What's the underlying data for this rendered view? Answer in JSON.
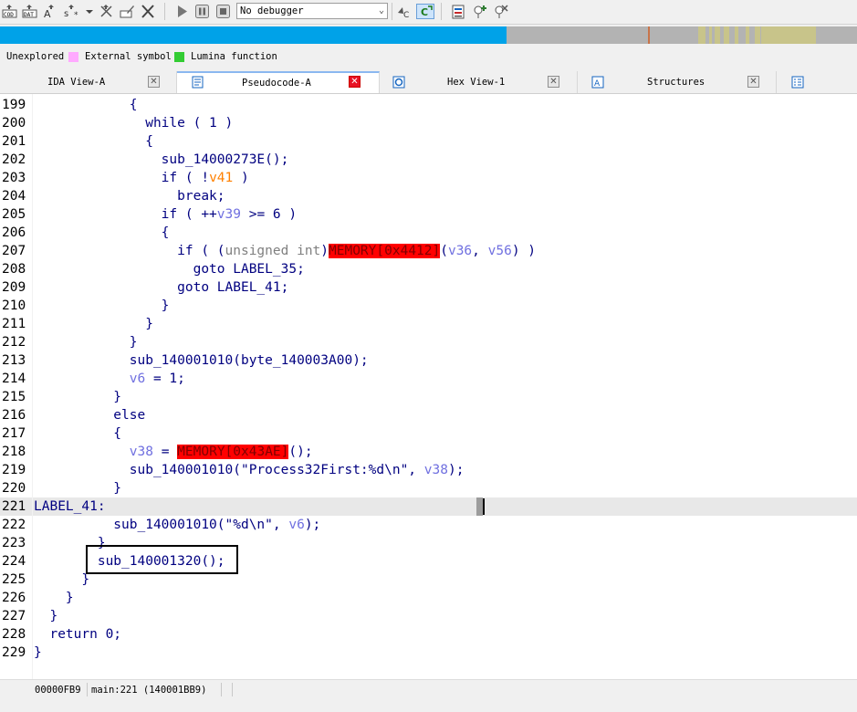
{
  "toolbar": {
    "debugger_value": "No debugger"
  },
  "legend": {
    "unexplored": "Unexplored",
    "external": "External symbol",
    "lumina": "Lumina function",
    "colors": {
      "external": "#ffaaff",
      "lumina": "#33cc33"
    }
  },
  "tabs": [
    {
      "label": "IDA View-A",
      "active": false
    },
    {
      "label": "Pseudocode-A",
      "active": true
    },
    {
      "label": "Hex View-1",
      "active": false
    },
    {
      "label": "Structures",
      "active": false
    }
  ],
  "code": {
    "lines": [
      {
        "num": "199",
        "parts": [
          {
            "t": "            {",
            "c": "code"
          }
        ]
      },
      {
        "num": "200",
        "parts": [
          {
            "t": "              while ( 1 )",
            "c": "code"
          }
        ]
      },
      {
        "num": "201",
        "parts": [
          {
            "t": "              {",
            "c": "code"
          }
        ]
      },
      {
        "num": "202",
        "parts": [
          {
            "t": "                sub_14000273E();",
            "c": "code"
          }
        ]
      },
      {
        "num": "203",
        "parts": [
          {
            "t": "                if ( !",
            "c": "code"
          },
          {
            "t": "v41",
            "c": "orange"
          },
          {
            "t": " )",
            "c": "code"
          }
        ]
      },
      {
        "num": "204",
        "parts": [
          {
            "t": "                  break;",
            "c": "code"
          }
        ]
      },
      {
        "num": "205",
        "parts": [
          {
            "t": "                if ( ++",
            "c": "code"
          },
          {
            "t": "v39",
            "c": "var"
          },
          {
            "t": " >= 6 )",
            "c": "code"
          }
        ]
      },
      {
        "num": "206",
        "parts": [
          {
            "t": "                {",
            "c": "code"
          }
        ]
      },
      {
        "num": "207",
        "parts": [
          {
            "t": "                  if ( (",
            "c": "code"
          },
          {
            "t": "unsigned int",
            "c": "gray"
          },
          {
            "t": ")",
            "c": "code"
          },
          {
            "t": "MEMORY[0x4412]",
            "c": "red"
          },
          {
            "t": "(",
            "c": "code"
          },
          {
            "t": "v36",
            "c": "var"
          },
          {
            "t": ", ",
            "c": "code"
          },
          {
            "t": "v56",
            "c": "var"
          },
          {
            "t": ") )",
            "c": "code"
          }
        ]
      },
      {
        "num": "208",
        "parts": [
          {
            "t": "                    goto LABEL_35;",
            "c": "code"
          }
        ]
      },
      {
        "num": "209",
        "parts": [
          {
            "t": "                  goto LABEL_41;",
            "c": "code"
          }
        ]
      },
      {
        "num": "210",
        "parts": [
          {
            "t": "                }",
            "c": "code"
          }
        ]
      },
      {
        "num": "211",
        "parts": [
          {
            "t": "              }",
            "c": "code"
          }
        ]
      },
      {
        "num": "212",
        "parts": [
          {
            "t": "            }",
            "c": "code"
          }
        ]
      },
      {
        "num": "213",
        "parts": [
          {
            "t": "            sub_140001010(byte_140003A00);",
            "c": "code"
          }
        ]
      },
      {
        "num": "214",
        "parts": [
          {
            "t": "            ",
            "c": "code"
          },
          {
            "t": "v6",
            "c": "var"
          },
          {
            "t": " = 1;",
            "c": "code"
          }
        ]
      },
      {
        "num": "215",
        "parts": [
          {
            "t": "          }",
            "c": "code"
          }
        ]
      },
      {
        "num": "216",
        "parts": [
          {
            "t": "          else",
            "c": "code"
          }
        ]
      },
      {
        "num": "217",
        "parts": [
          {
            "t": "          {",
            "c": "code"
          }
        ]
      },
      {
        "num": "218",
        "parts": [
          {
            "t": "            ",
            "c": "code"
          },
          {
            "t": "v38",
            "c": "var"
          },
          {
            "t": " = ",
            "c": "code"
          },
          {
            "t": "MEMORY[0x43AE]",
            "c": "red"
          },
          {
            "t": "();",
            "c": "code"
          }
        ]
      },
      {
        "num": "219",
        "parts": [
          {
            "t": "            sub_140001010(\"Process32First:%d\\n\", ",
            "c": "code"
          },
          {
            "t": "v38",
            "c": "var"
          },
          {
            "t": ");",
            "c": "code"
          }
        ]
      },
      {
        "num": "220",
        "parts": [
          {
            "t": "          }",
            "c": "code"
          }
        ]
      },
      {
        "num": "221",
        "parts": [
          {
            "t": "LABEL_41:",
            "c": "code"
          }
        ]
      },
      {
        "num": "222",
        "parts": [
          {
            "t": "          sub_140001010(\"%d\\n\", ",
            "c": "code"
          },
          {
            "t": "v6",
            "c": "var"
          },
          {
            "t": ");",
            "c": "code"
          }
        ]
      },
      {
        "num": "223",
        "parts": [
          {
            "t": "        }",
            "c": "code"
          }
        ]
      },
      {
        "num": "224",
        "parts": [
          {
            "t": "        sub_140001320();",
            "c": "code"
          }
        ]
      },
      {
        "num": "225",
        "parts": [
          {
            "t": "      }",
            "c": "code"
          }
        ]
      },
      {
        "num": "226",
        "parts": [
          {
            "t": "    }",
            "c": "code"
          }
        ]
      },
      {
        "num": "227",
        "parts": [
          {
            "t": "  }",
            "c": "code"
          }
        ]
      },
      {
        "num": "228",
        "parts": [
          {
            "t": "  return 0;",
            "c": "code"
          }
        ]
      },
      {
        "num": "229",
        "parts": [
          {
            "t": "}",
            "c": "code"
          }
        ]
      }
    ],
    "current_line": "221"
  },
  "status": {
    "offset": "00000FB9",
    "location": "main:221 (140001BB9)"
  },
  "colors": {
    "nav_code": "#00a2e8",
    "nav_gray": "#b3b3b3",
    "nav_olive": "#c8c48a",
    "red_highlight": "#ff0000",
    "code_text": "#000080",
    "var_text": "#7070e0",
    "active_close": "#e81123"
  }
}
